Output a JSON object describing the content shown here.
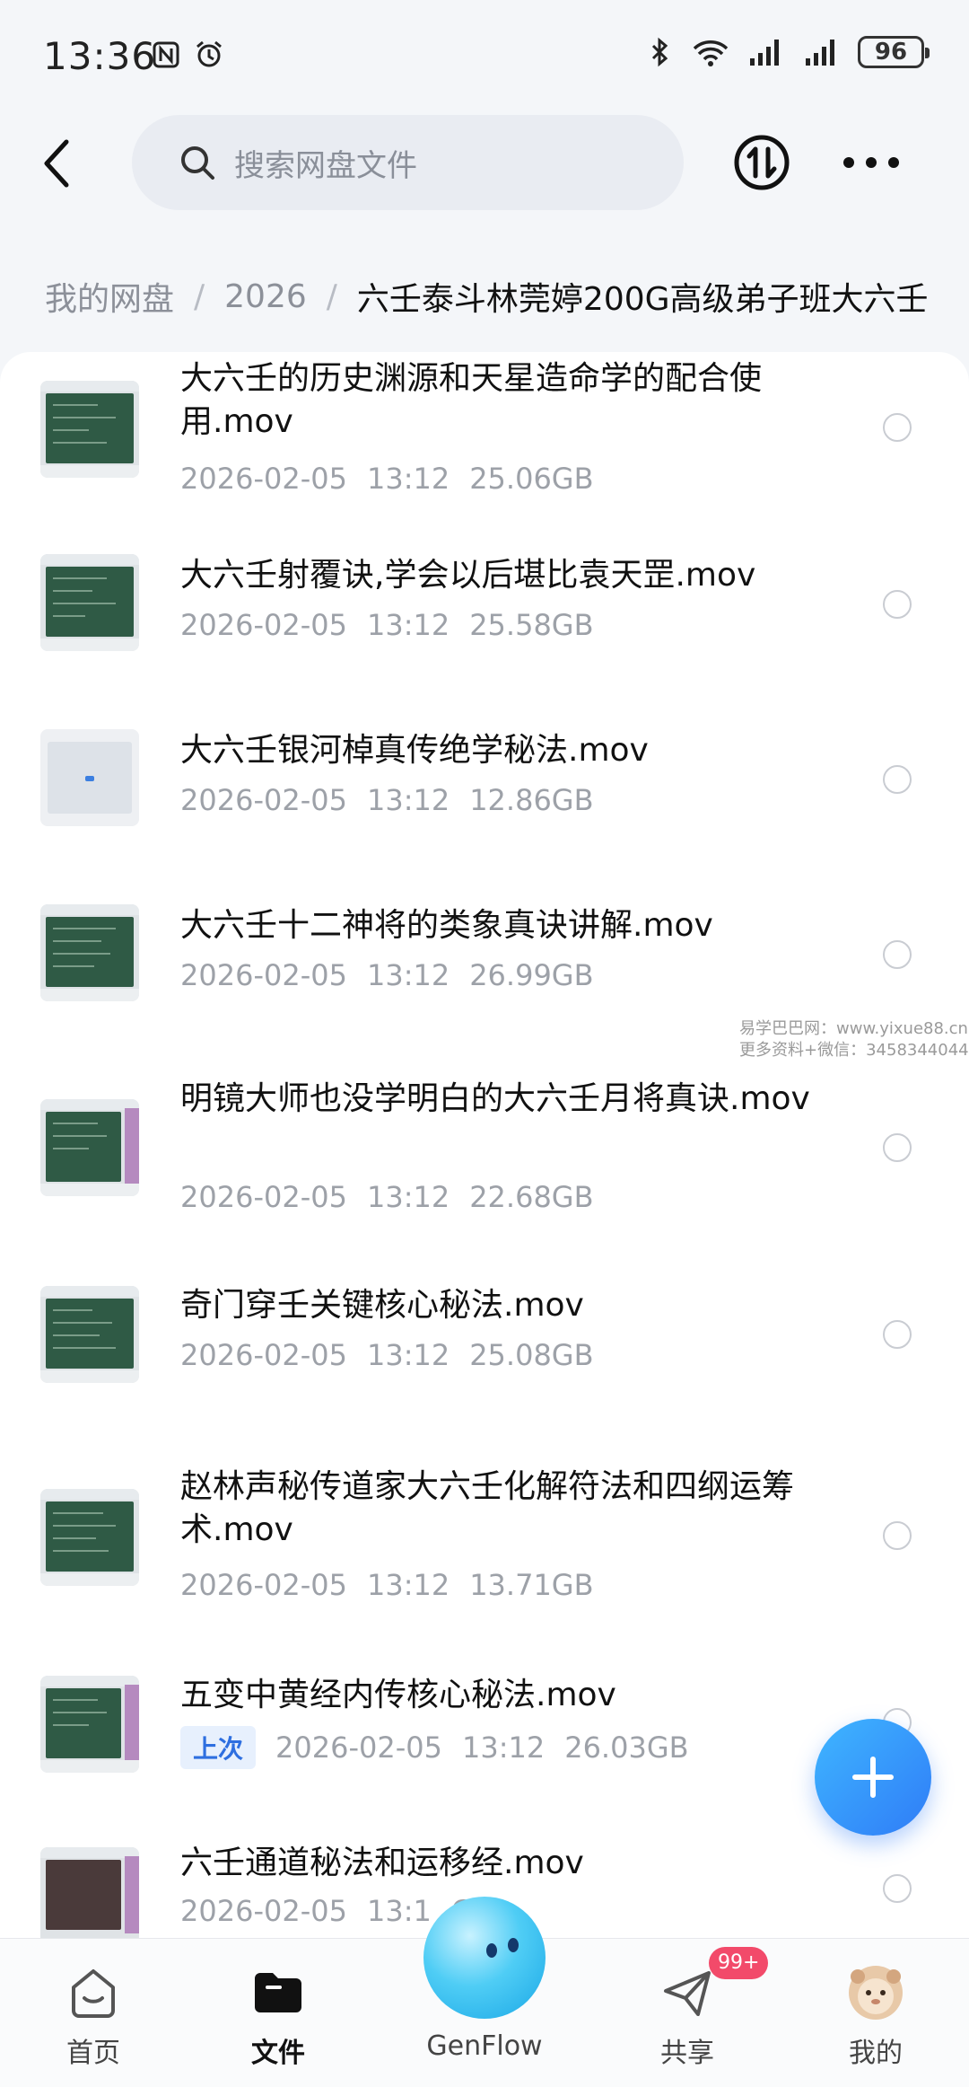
{
  "status_bar": {
    "time": "13:36",
    "battery": "96",
    "left_icons": [
      "nfc-icon",
      "alarm-icon"
    ],
    "right_icons": [
      "bluetooth-icon",
      "wifi-icon",
      "signal-icon",
      "signal-icon",
      "battery-icon"
    ]
  },
  "header": {
    "search_placeholder": "搜索网盘文件",
    "back_icon": "chevron-left-icon",
    "transfer_icon": "transfer-icon",
    "more_icon": "more-icon"
  },
  "breadcrumb": {
    "items": [
      "我的网盘",
      "2026"
    ],
    "separator": "/",
    "current": "六壬泰斗林莞婷200G高级弟子班大六壬"
  },
  "files": [
    {
      "name": "大六壬的历史渊源和天星造命学的配合使用.mov",
      "date": "2026-02-05",
      "time": "13:12",
      "size": "25.06GB",
      "badge": ""
    },
    {
      "name": "大六壬射覆诀,学会以后堪比袁天罡.mov",
      "date": "2026-02-05",
      "time": "13:12",
      "size": "25.58GB",
      "badge": ""
    },
    {
      "name": "大六壬银河棹真传绝学秘法.mov",
      "date": "2026-02-05",
      "time": "13:12",
      "size": "12.86GB",
      "badge": ""
    },
    {
      "name": "大六壬十二神将的类象真诀讲解.mov",
      "date": "2026-02-05",
      "time": "13:12",
      "size": "26.99GB",
      "badge": ""
    },
    {
      "name": "明镜大师也没学明白的大六壬月将真诀.mov",
      "date": "2026-02-05",
      "time": "13:12",
      "size": "22.68GB",
      "badge": ""
    },
    {
      "name": "奇门穿壬关键核心秘法.mov",
      "date": "2026-02-05",
      "time": "13:12",
      "size": "25.08GB",
      "badge": ""
    },
    {
      "name": "赵林声秘传道家大六壬化解符法和四纲运筹术.mov",
      "date": "2026-02-05",
      "time": "13:12",
      "size": "13.71GB",
      "badge": ""
    },
    {
      "name": "五变中黄经内传核心秘法.mov",
      "date": "2026-02-05",
      "time": "13:12",
      "size": "26.03GB",
      "badge": "上次"
    },
    {
      "name": "六壬通道秘法和运移经.mov",
      "date": "2026-02-05",
      "time": "13:1",
      "size": "GB",
      "badge": ""
    }
  ],
  "watermark": {
    "line1": "易学巴巴网：www.yixue88.cn",
    "line2": "更多资料+微信：3458344044"
  },
  "fab_icon": "plus-icon",
  "bottom_nav": {
    "items": [
      {
        "label": "首页",
        "icon": "home-icon",
        "active": false
      },
      {
        "label": "文件",
        "icon": "folder-icon",
        "active": true
      },
      {
        "label": "GenFlow",
        "icon": "genflow-icon",
        "active": false
      },
      {
        "label": "共享",
        "icon": "share-icon",
        "active": false
      },
      {
        "label": "我的",
        "icon": "avatar-icon",
        "active": false
      }
    ],
    "share_badge": "99+"
  },
  "colors": {
    "accent": "#2f7cf7",
    "badge_red": "#f24a6a",
    "meta_gray": "#9da1a8"
  }
}
